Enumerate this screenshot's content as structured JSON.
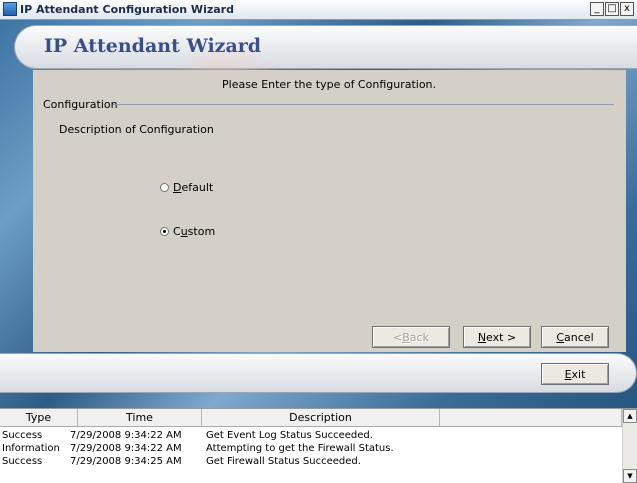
{
  "window": {
    "title": "IP Attendant Configuration Wizard",
    "controls": {
      "minimize": "_",
      "maximize": "□",
      "close": "x"
    }
  },
  "header": {
    "title": "IP Attendant Wizard"
  },
  "main": {
    "instruction": "Please Enter the type of Configuration.",
    "group_label": "Configuration",
    "group_description": "Description of Configuration",
    "options": [
      {
        "prefix": "",
        "mnemonic": "D",
        "suffix": "efault",
        "checked": false
      },
      {
        "prefix": "C",
        "mnemonic": "u",
        "suffix": "stom",
        "checked": true
      }
    ]
  },
  "buttons": {
    "back": {
      "prefix": "< ",
      "mnemonic": "B",
      "suffix": "ack",
      "enabled": false
    },
    "next": {
      "prefix": "",
      "mnemonic": "N",
      "suffix": "ext >",
      "enabled": true
    },
    "cancel": {
      "prefix": "",
      "mnemonic": "C",
      "suffix": "ancel",
      "enabled": true
    },
    "exit": {
      "prefix": "",
      "mnemonic": "E",
      "suffix": "xit",
      "enabled": true
    }
  },
  "log": {
    "columns": [
      "Type",
      "Time",
      "Description",
      ""
    ],
    "rows": [
      {
        "type": "Success",
        "time": "7/29/2008 9:34:22 AM",
        "description": "Get Event Log Status Succeeded."
      },
      {
        "type": "Information",
        "time": "7/29/2008 9:34:22 AM",
        "description": "Attempting to get the Firewall Status."
      },
      {
        "type": "Success",
        "time": "7/29/2008 9:34:25 AM",
        "description": "Get Firewall Status Succeeded."
      }
    ]
  },
  "icons": {
    "app": "app-icon",
    "scroll_up": "▲",
    "scroll_down": "▼"
  },
  "colors": {
    "title_accent": "#3a4f88",
    "panel": "#d4d0c8",
    "group_line": "#8f9db0"
  }
}
